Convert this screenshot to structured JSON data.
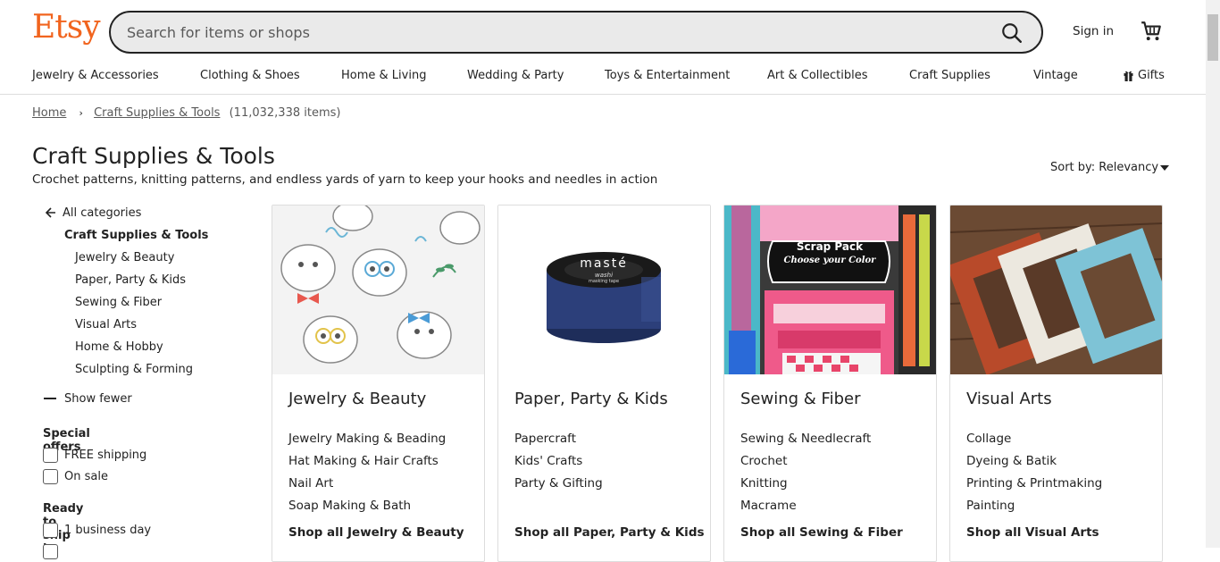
{
  "header": {
    "logo": "Etsy",
    "search_placeholder": "Search for items or shops",
    "signin_label": "Sign in"
  },
  "nav": {
    "items": [
      "Jewelry & Accessories",
      "Clothing & Shoes",
      "Home & Living",
      "Wedding & Party",
      "Toys & Entertainment",
      "Art & Collectibles",
      "Craft Supplies",
      "Vintage",
      "Gifts"
    ]
  },
  "breadcrumb": {
    "home": "Home",
    "current": "Craft Supplies & Tools",
    "count": "(11,032,338 items)"
  },
  "page": {
    "title": "Craft Supplies & Tools",
    "description": "Crochet patterns, knitting patterns, and endless yards of yarn to keep your hooks and needles in action",
    "sort_label": "Sort by: Relevancy"
  },
  "sidebar": {
    "all_categories": "All categories",
    "current_category": "Craft Supplies & Tools",
    "subcategories": [
      "Jewelry & Beauty",
      "Paper, Party & Kids",
      "Sewing & Fiber",
      "Visual Arts",
      "Home & Hobby",
      "Sculpting & Forming"
    ],
    "show_fewer": "Show fewer",
    "special_offers_heading": "Special offers",
    "special_offers": [
      "FREE shipping",
      "On sale"
    ],
    "ship_heading": "Ready to ship in",
    "ship_options": [
      "1 business day"
    ]
  },
  "cards": [
    {
      "title": "Jewelry & Beauty",
      "links": [
        "Jewelry Making & Beading",
        "Hat Making & Hair Crafts",
        "Nail Art",
        "Soap Making & Bath"
      ],
      "shop_all": "Shop all Jewelry & Beauty"
    },
    {
      "title": "Paper, Party & Kids",
      "links": [
        "Papercraft",
        "Kids' Crafts",
        "Party & Gifting"
      ],
      "shop_all": "Shop all Paper, Party & Kids",
      "tape_brand": "masté",
      "tape_sub1": "washi",
      "tape_sub2": "masking tape"
    },
    {
      "title": "Sewing & Fiber",
      "links": [
        "Sewing & Needlecraft",
        "Crochet",
        "Knitting",
        "Macrame"
      ],
      "shop_all": "Shop all Sewing & Fiber",
      "badge_line1": "Scrap Pack",
      "badge_line2": "Choose your Color"
    },
    {
      "title": "Visual Arts",
      "links": [
        "Collage",
        "Dyeing & Batik",
        "Printing & Printmaking",
        "Painting"
      ],
      "shop_all": "Shop all Visual Arts"
    }
  ],
  "colors": {
    "brand": "#f1641e",
    "text": "#222222",
    "muted": "#595959",
    "search_bg": "#eaeaea"
  }
}
